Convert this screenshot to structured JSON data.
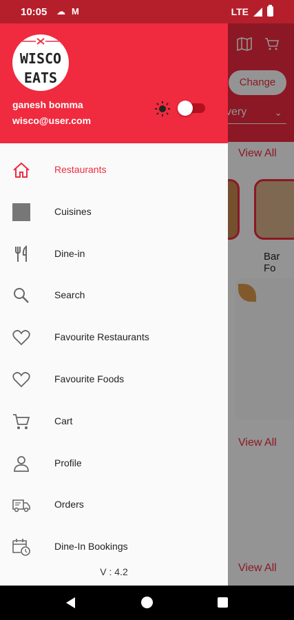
{
  "status_bar": {
    "time": "10:05",
    "network": "LTE"
  },
  "background_screen": {
    "change_button": "Change",
    "delivery_select": "elivery",
    "view_all_1": "View All",
    "view_all_2": "View All",
    "view_all_3": "View All",
    "category_label": "Bar Fo"
  },
  "drawer": {
    "logo_text_top": "WISCO",
    "logo_text_bottom": "EATS",
    "user_name": "ganesh bomma",
    "user_email": "wisco@user.com",
    "theme_toggle_on": true,
    "items": [
      {
        "label": "Restaurants",
        "icon": "home-icon",
        "active": true
      },
      {
        "label": "Cuisines",
        "icon": "square-icon",
        "active": false
      },
      {
        "label": "Dine-in",
        "icon": "fork-knife-icon",
        "active": false
      },
      {
        "label": "Search",
        "icon": "search-icon",
        "active": false
      },
      {
        "label": "Favourite Restaurants",
        "icon": "heart-icon",
        "active": false
      },
      {
        "label": "Favourite Foods",
        "icon": "heart-icon",
        "active": false
      },
      {
        "label": "Cart",
        "icon": "cart-icon",
        "active": false
      },
      {
        "label": "Profile",
        "icon": "person-icon",
        "active": false
      },
      {
        "label": "Orders",
        "icon": "delivery-truck-icon",
        "active": false
      },
      {
        "label": "Dine-In Bookings",
        "icon": "calendar-clock-icon",
        "active": false
      }
    ],
    "version": "V : 4.2"
  },
  "colors": {
    "accent": "#f02a3f",
    "status_bar": "#b51f2c",
    "toggle_track": "#b3101f",
    "icon_grey": "#666666"
  }
}
